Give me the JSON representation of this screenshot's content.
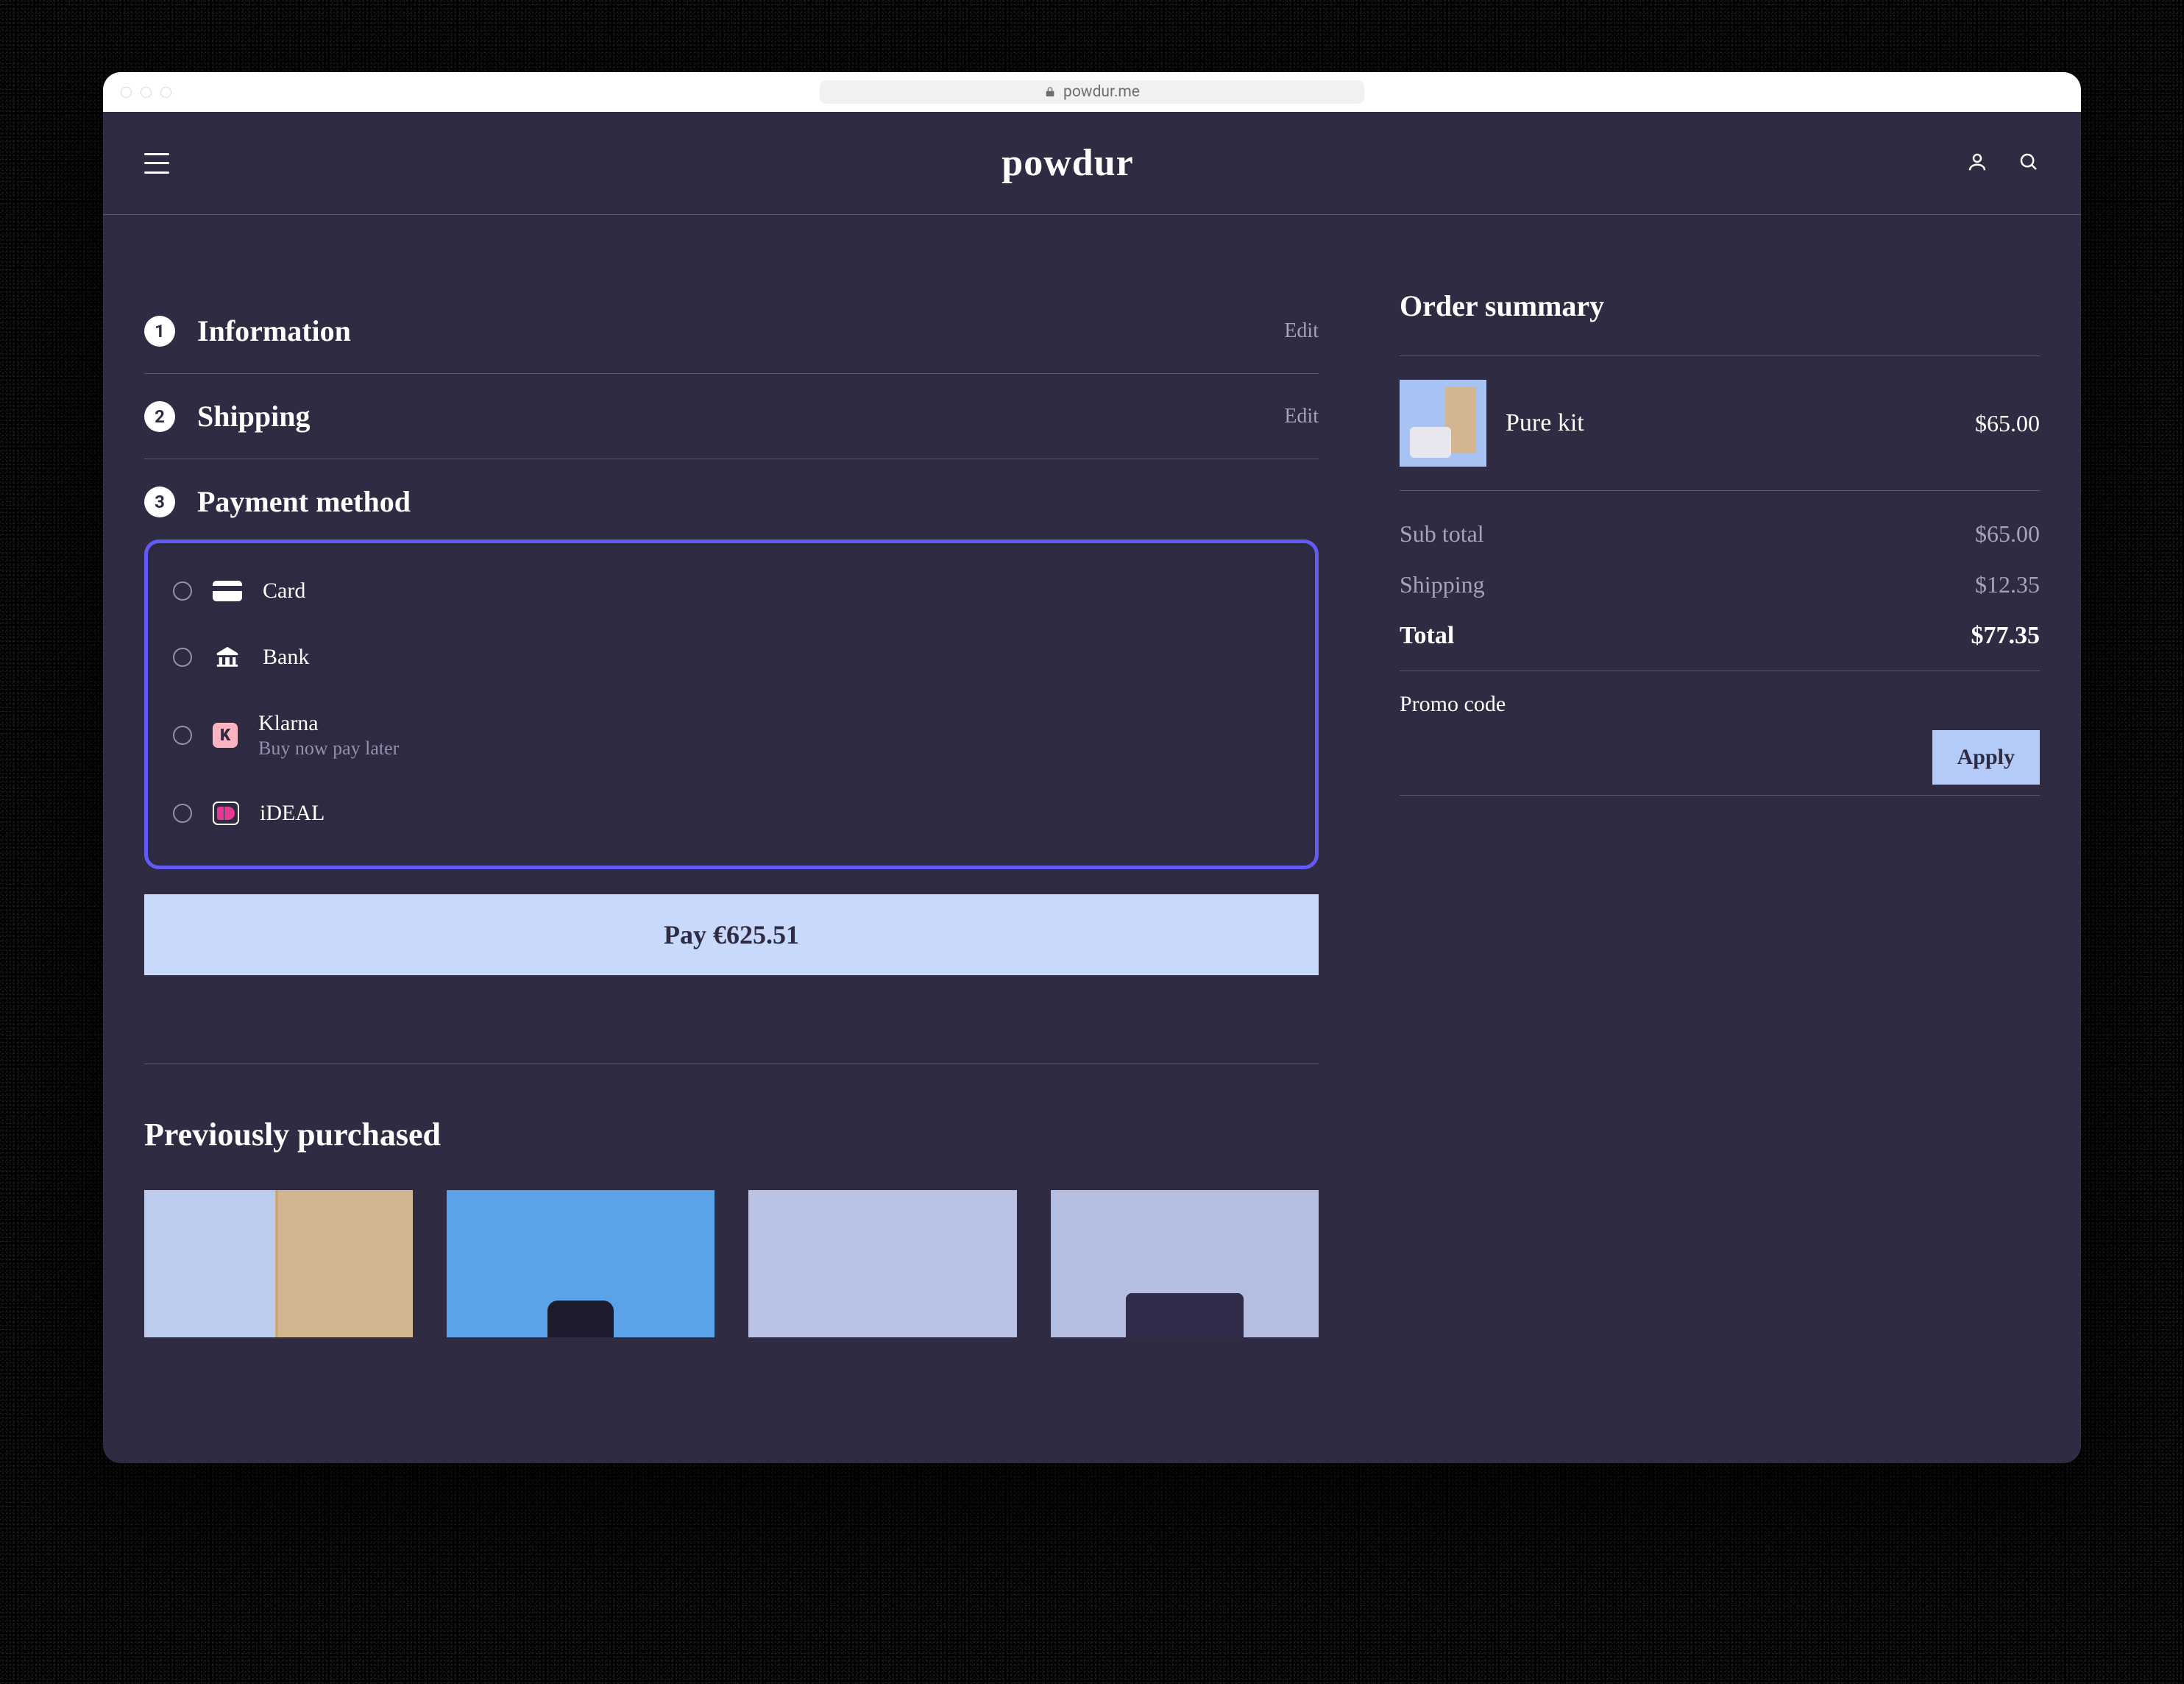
{
  "browser": {
    "url": "powdur.me"
  },
  "header": {
    "brand": "powdur"
  },
  "steps": {
    "information": {
      "num": "1",
      "title": "Information",
      "edit": "Edit"
    },
    "shipping": {
      "num": "2",
      "title": "Shipping",
      "edit": "Edit"
    },
    "payment": {
      "num": "3",
      "title": "Payment method"
    }
  },
  "payment_methods": {
    "card": {
      "label": "Card"
    },
    "bank": {
      "label": "Bank"
    },
    "klarna": {
      "label": "Klarna",
      "sub": "Buy now pay later",
      "badge": "K"
    },
    "ideal": {
      "label": "iDEAL"
    }
  },
  "pay_button": "Pay €625.51",
  "previously_purchased_title": "Previously purchased",
  "summary": {
    "title": "Order summary",
    "item": {
      "name": "Pure kit",
      "price": "$65.00"
    },
    "subtotal": {
      "label": "Sub total",
      "value": "$65.00"
    },
    "shipping": {
      "label": "Shipping",
      "value": "$12.35"
    },
    "total": {
      "label": "Total",
      "value": "$77.35"
    },
    "promo": {
      "label": "Promo code",
      "apply": "Apply"
    }
  }
}
